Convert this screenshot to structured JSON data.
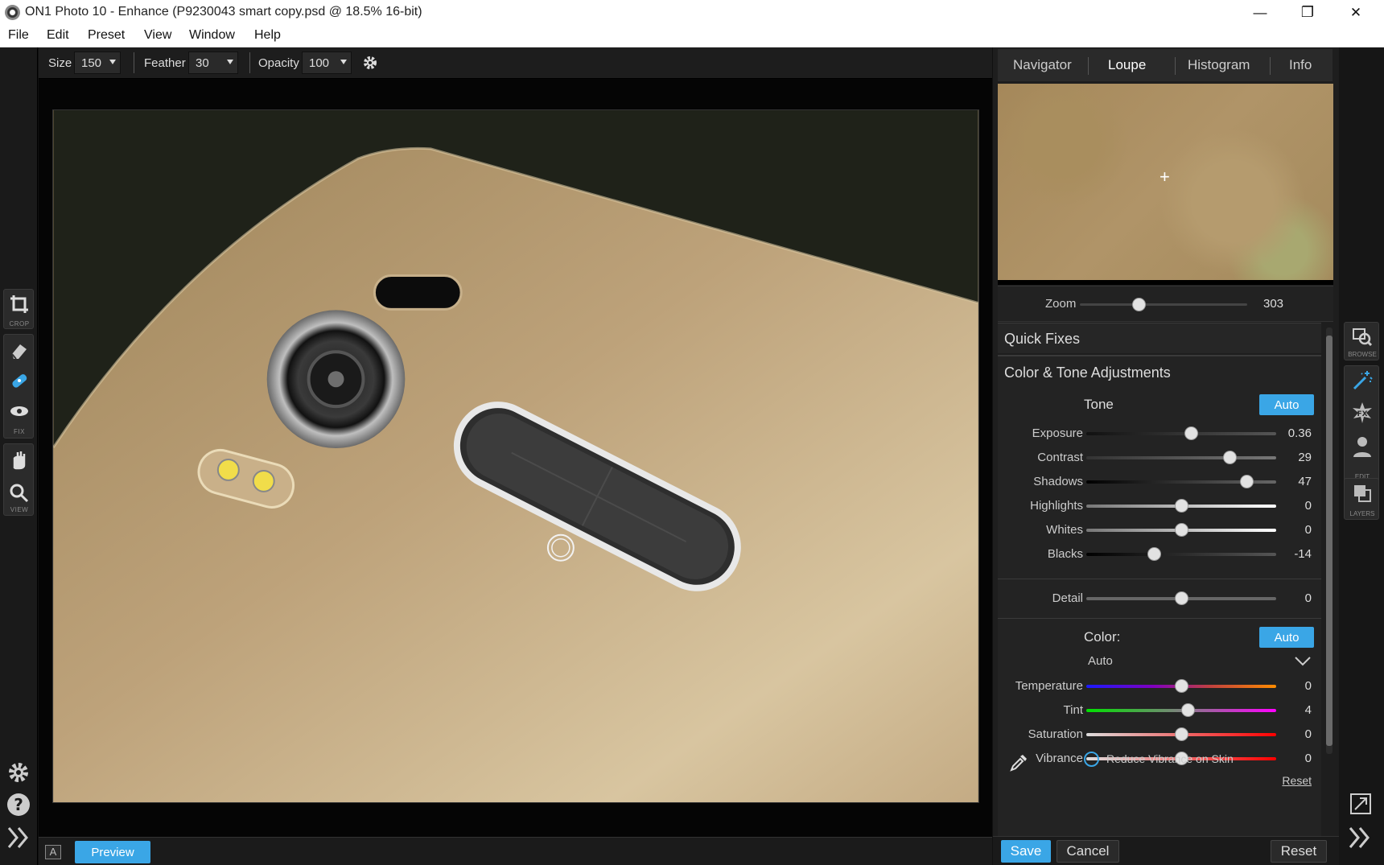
{
  "window": {
    "title": "ON1 Photo 10 - Enhance (P9230043 smart copy.psd @ 18.5% 16-bit)",
    "controls": {
      "minimize": "—",
      "maximize": "❐",
      "close": "✕"
    }
  },
  "menu": [
    "File",
    "Edit",
    "Preset",
    "View",
    "Window",
    "Help"
  ],
  "toolbar": {
    "size_label": "Size",
    "size_value": "150",
    "feather_label": "Feather",
    "feather_value": "30",
    "opacity_label": "Opacity",
    "opacity_value": "100",
    "settings_icon": "gear-icon"
  },
  "left_tools": {
    "crop_caption": "CROP",
    "fix_caption": "FIX",
    "view_caption": "VIEW"
  },
  "bottom": {
    "badge": "A",
    "preview_label": "Preview"
  },
  "panel": {
    "tabs": [
      "Navigator",
      "Loupe",
      "Histogram",
      "Info"
    ],
    "active_tab": "Loupe",
    "zoom_label": "Zoom",
    "zoom_value": "303",
    "zoom_fraction": 0.35,
    "quick_fixes": "Quick Fixes",
    "color_tone": "Color & Tone Adjustments",
    "tone_label": "Tone",
    "auto_label": "Auto",
    "tone_sliders": [
      {
        "label": "Exposure",
        "value": "0.36",
        "pos": 0.55
      },
      {
        "label": "Contrast",
        "value": "29",
        "pos": 0.755
      },
      {
        "label": "Shadows",
        "value": "47",
        "pos": 0.845
      },
      {
        "label": "Highlights",
        "value": "0",
        "pos": 0.5
      },
      {
        "label": "Whites",
        "value": "0",
        "pos": 0.5
      },
      {
        "label": "Blacks",
        "value": "-14",
        "pos": 0.355
      }
    ],
    "detail": {
      "label": "Detail",
      "value": "0",
      "pos": 0.5
    },
    "color_label": "Color:",
    "color_mode": "Auto",
    "color_sliders": [
      {
        "label": "Temperature",
        "value": "0",
        "pos": 0.5
      },
      {
        "label": "Tint",
        "value": "4",
        "pos": 0.535
      },
      {
        "label": "Saturation",
        "value": "0",
        "pos": 0.5
      },
      {
        "label": "Vibrance",
        "value": "0",
        "pos": 0.5
      }
    ],
    "reduce_vibrance": "Reduce Vibrance on Skin",
    "reset_link": "Reset",
    "footer": {
      "save": "Save",
      "cancel": "Cancel",
      "reset": "Reset"
    }
  },
  "modules": {
    "browse": "BROWSE",
    "edit": "EDIT",
    "layers": "LAYERS"
  },
  "colors": {
    "accent": "#3aa6e6",
    "panel_bg": "#1e1e1e",
    "canvas_bg": "#050505"
  }
}
